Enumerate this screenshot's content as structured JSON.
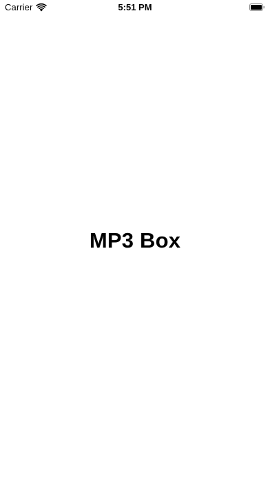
{
  "status_bar": {
    "carrier": "Carrier",
    "time": "5:51 PM",
    "wifi_icon": "wifi-icon",
    "battery_icon": "battery-icon",
    "battery_level": 1.0
  },
  "main": {
    "title": "MP3 Box"
  },
  "colors": {
    "background": "#ffffff",
    "text": "#000000"
  }
}
